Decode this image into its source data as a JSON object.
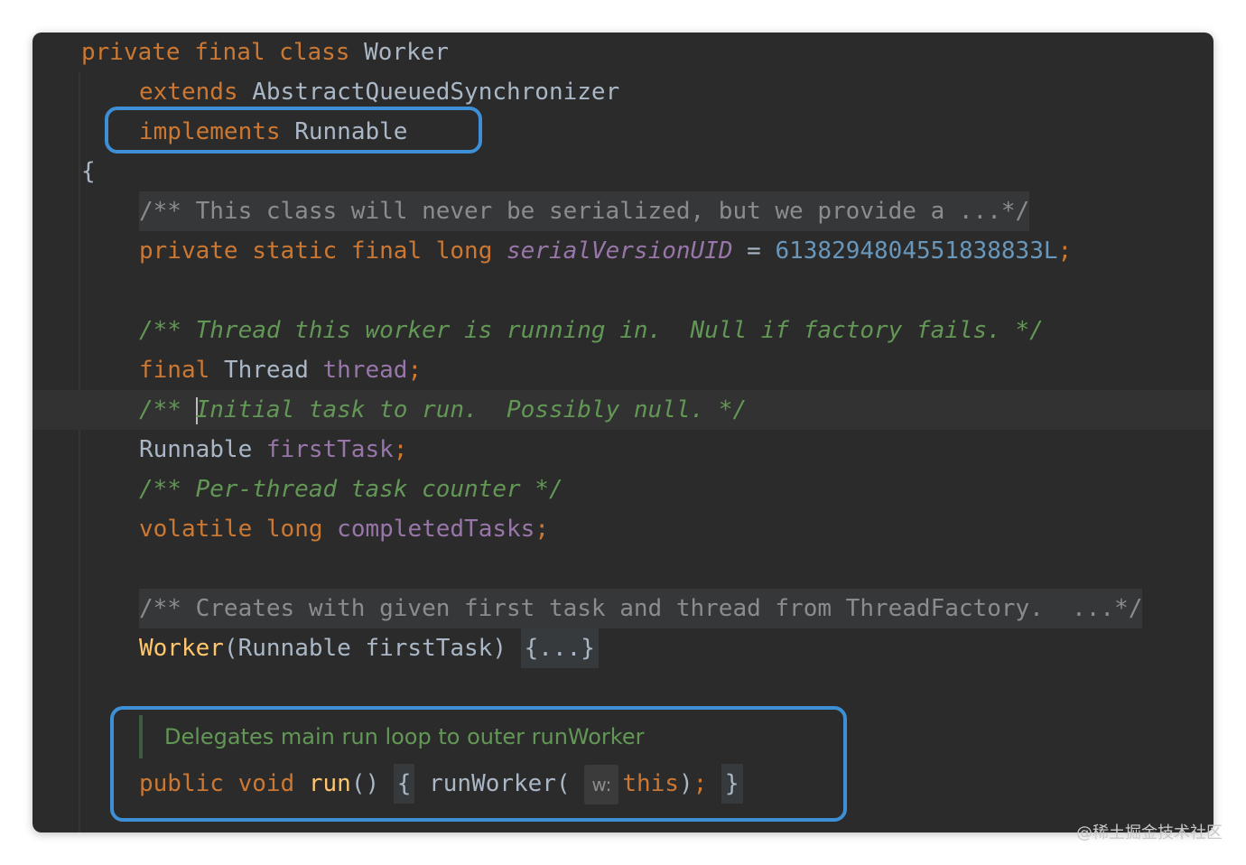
{
  "code": {
    "l1": {
      "kw1": "private",
      "kw2": "final",
      "kw3": "class",
      "name": "Worker"
    },
    "l2": {
      "kw": "extends",
      "name": "AbstractQueuedSynchronizer"
    },
    "l3": {
      "kw": "implements",
      "name": "Runnable"
    },
    "l4": {
      "brace": "{"
    },
    "l5": {
      "doc": "/** This class will never be serialized, but we provide a ...*/"
    },
    "l6": {
      "kw1": "private",
      "kw2": "static",
      "kw3": "final",
      "kw4": "long",
      "field": "serialVersionUID",
      "eq": "=",
      "num": "6138294804551838833L",
      "semi": ";"
    },
    "l8": {
      "doc": "/** Thread this worker is running in.  Null if factory fails. */"
    },
    "l9": {
      "kw": "final",
      "type": "Thread",
      "field": "thread",
      "semi": ";"
    },
    "l10": {
      "doc_start": "/** ",
      "doc_rest": "Initial task to run.  Possibly null. */"
    },
    "l11": {
      "type": "Runnable",
      "field": "firstTask",
      "semi": ";"
    },
    "l12": {
      "doc": "/** Per-thread task counter */"
    },
    "l13": {
      "kw1": "volatile",
      "kw2": "long",
      "field": "completedTasks",
      "semi": ";"
    },
    "l15": {
      "doc": "/** Creates with given first task and thread from ThreadFactory.  ...*/"
    },
    "l16": {
      "method": "Worker",
      "params": "(Runnable firstTask)",
      "fold": "{...}"
    },
    "rendered_doc": "Delegates main run loop to outer runWorker",
    "l18": {
      "kw1": "public",
      "kw2": "void",
      "method": "run",
      "parens": "()",
      "open": "{",
      "call": "runWorker(",
      "hint": "w:",
      "this": "this",
      "close_paren": ")",
      "semi": ";",
      "close": "}"
    }
  },
  "watermark": "@稀土掘金技术社区",
  "colors": {
    "background": "#2b2b2b",
    "keyword": "#cc7832",
    "text": "#a9b7c6",
    "field": "#9876aa",
    "number": "#6897bb",
    "doc_comment": "#629755",
    "method": "#ffc66d",
    "highlight_box": "#3d8fd6"
  }
}
